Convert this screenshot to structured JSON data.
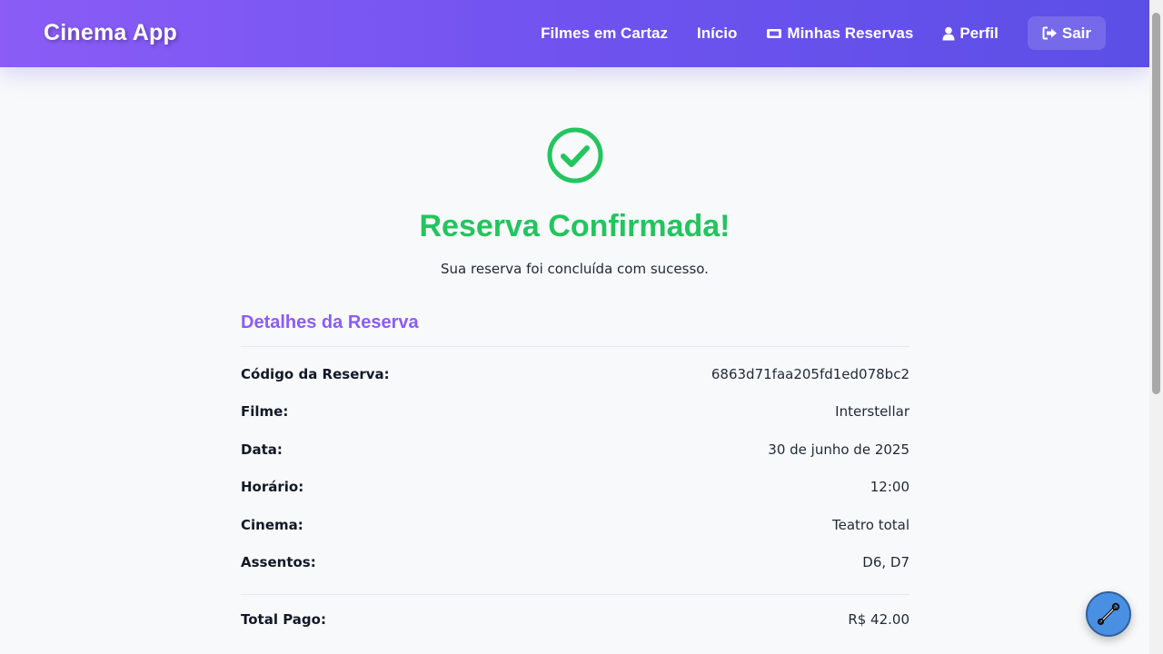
{
  "nav": {
    "brand": "Cinema App",
    "links": [
      {
        "label": "Filmes em Cartaz"
      },
      {
        "label": "Início"
      },
      {
        "label": "Minhas Reservas",
        "icon": "ticket-icon"
      },
      {
        "label": "Perfil",
        "icon": "user-icon"
      }
    ],
    "logout": {
      "label": "Sair",
      "icon": "logout-icon"
    }
  },
  "confirmation": {
    "icon": "check-circle-icon",
    "title": "Reserva Confirmada!",
    "subtitle": "Sua reserva foi concluída com sucesso."
  },
  "details": {
    "title": "Detalhes da Reserva",
    "rows": [
      {
        "label": "Código da Reserva:",
        "value": "6863d71faa205fd1ed078bc2"
      },
      {
        "label": "Filme:",
        "value": "Interstellar"
      },
      {
        "label": "Data:",
        "value": "30 de junho de 2025"
      },
      {
        "label": "Horário:",
        "value": "12:00"
      },
      {
        "label": "Cinema:",
        "value": "Teatro total"
      },
      {
        "label": "Assentos:",
        "value": "D6, D7"
      }
    ],
    "total": {
      "label": "Total Pago:",
      "value": "R$ 42.00"
    }
  },
  "fab": {
    "icon": "wrench-icon"
  },
  "colors": {
    "accent": "#8b5cf6",
    "success": "#22c55e",
    "nav_gradient_start": "#8b5cf6",
    "nav_gradient_end": "#5b4fe6",
    "fab": "#4a90e2"
  }
}
